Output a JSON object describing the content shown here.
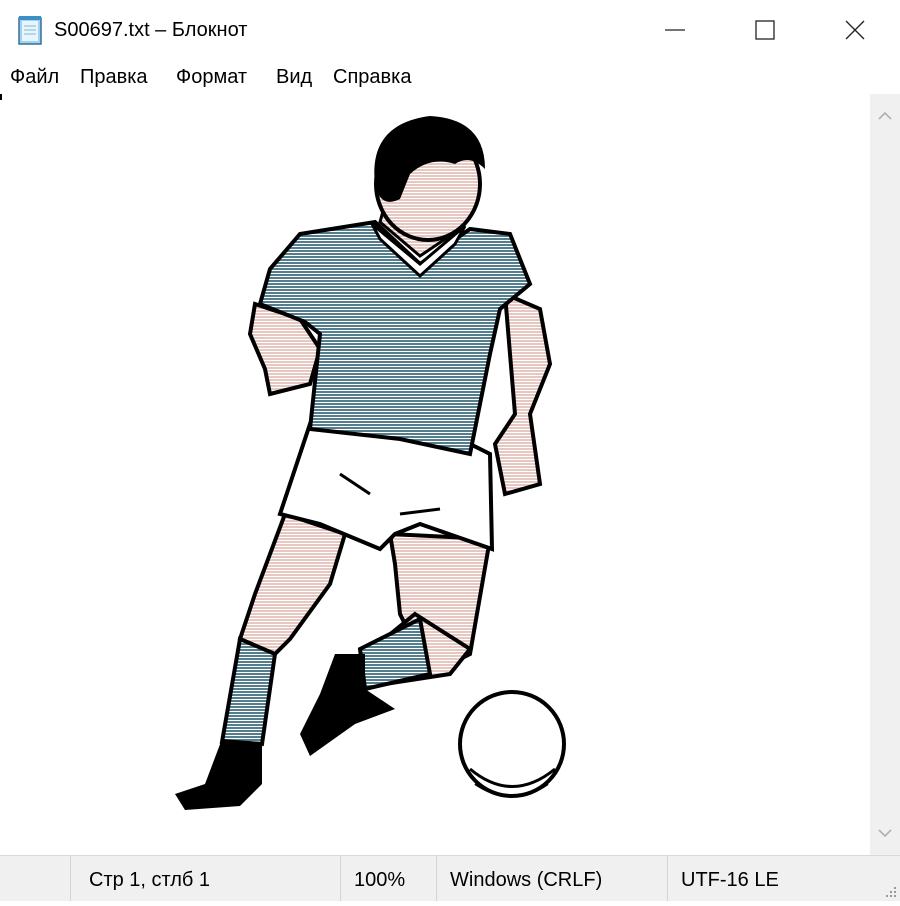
{
  "window": {
    "title": "S00697.txt – Блокнот",
    "icon": "notepad-icon",
    "controls": [
      "minimize-icon",
      "maximize-icon",
      "close-icon"
    ]
  },
  "menu": {
    "items": [
      "Файл",
      "Правка",
      "Формат",
      "Вид",
      "Справка"
    ]
  },
  "document": {
    "content_description_icon": "soccer-player-ascii-art",
    "colors": {
      "jersey": "#547e8e",
      "skin": "#e7c7c2",
      "outline": "#000000",
      "shorts": "#ffffff"
    }
  },
  "statusbar": {
    "position": "Стр 1, стлб 1",
    "zoom": "100%",
    "line_ending": "Windows (CRLF)",
    "encoding": "UTF-16 LE"
  }
}
